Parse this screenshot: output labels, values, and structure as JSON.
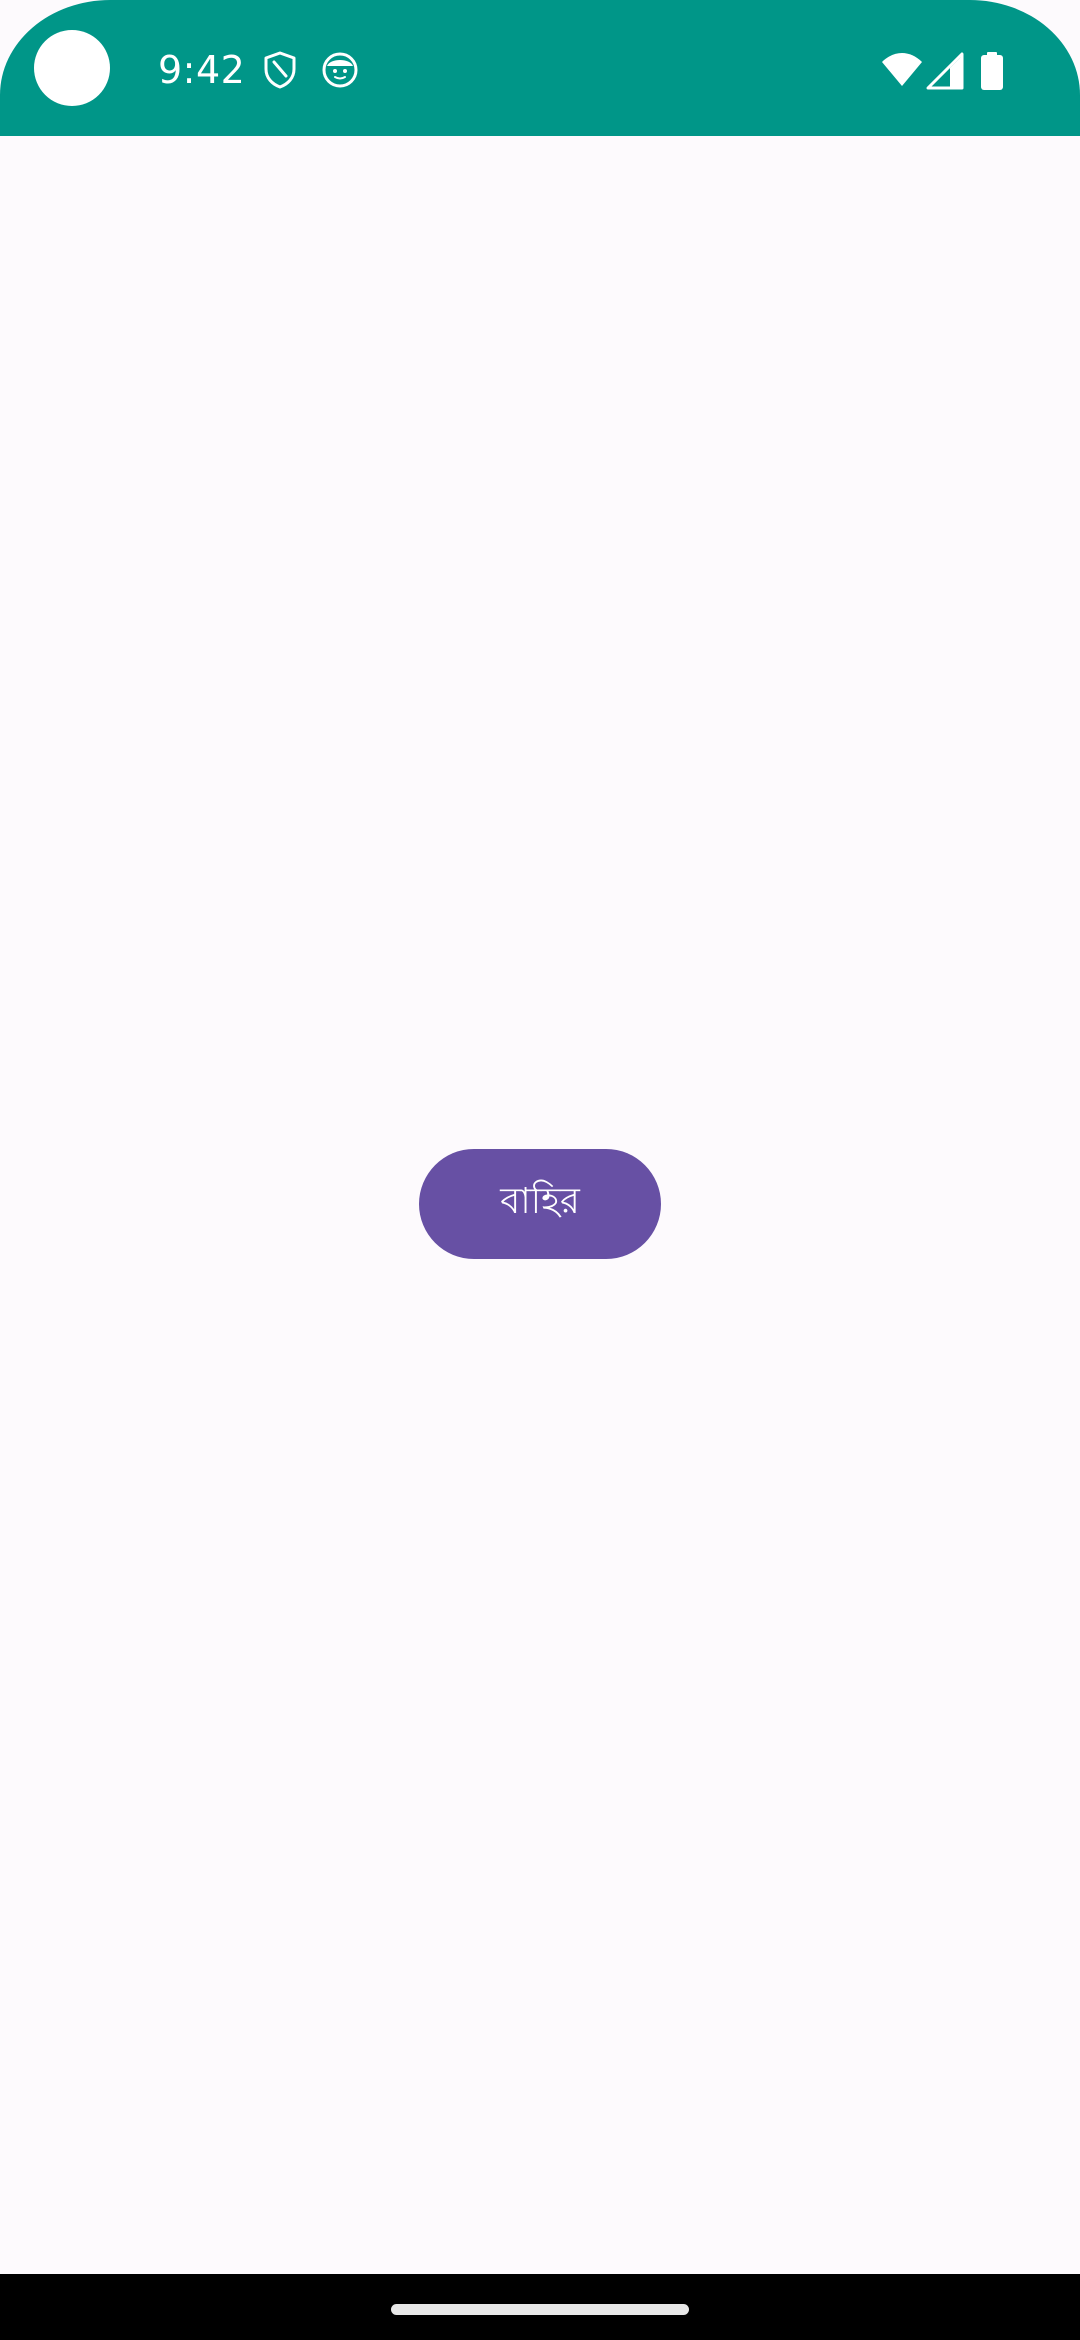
{
  "status_bar": {
    "time": "9:42",
    "background_color": "#009688",
    "icons": [
      "shield-icon",
      "face-icon",
      "wifi-icon",
      "cell-signal-icon",
      "battery-icon"
    ]
  },
  "main": {
    "background_color": "#FDFAFD",
    "exit_button": {
      "label": "বাহির",
      "color": "#6750A4"
    }
  },
  "navigation": {
    "handle_color": "#E8E8E8"
  }
}
